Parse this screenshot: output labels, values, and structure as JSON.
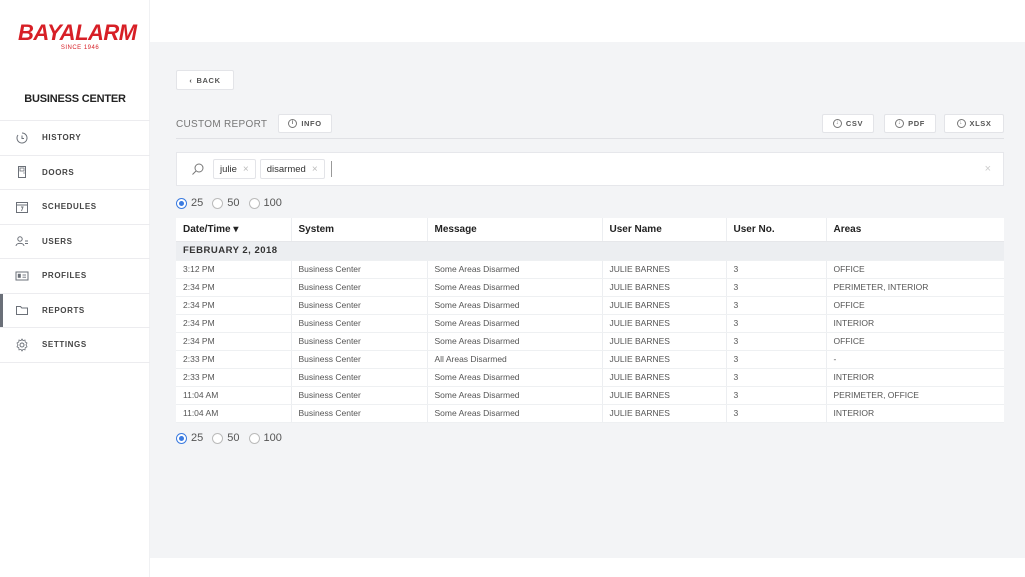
{
  "brand": {
    "name": "BAYALARM",
    "tagline": "SINCE 1946",
    "color": "#d71f26"
  },
  "account_name": "BUSINESS CENTER",
  "nav": [
    {
      "label": "HISTORY",
      "icon": "history-icon",
      "active": false
    },
    {
      "label": "DOORS",
      "icon": "door-icon",
      "active": false
    },
    {
      "label": "SCHEDULES",
      "icon": "calendar-icon",
      "active": false
    },
    {
      "label": "USERS",
      "icon": "users-icon",
      "active": false
    },
    {
      "label": "PROFILES",
      "icon": "profile-card-icon",
      "active": false
    },
    {
      "label": "REPORTS",
      "icon": "folder-icon",
      "active": true
    },
    {
      "label": "SETTINGS",
      "icon": "gear-icon",
      "active": false
    }
  ],
  "back_label": "BACK",
  "report_title": "CUSTOM REPORT",
  "info_label": "INFO",
  "exports": [
    "CSV",
    "PDF",
    "XLSX"
  ],
  "search": {
    "tags": [
      "julie",
      "disarmed"
    ],
    "tag_close": "×",
    "clear": "×"
  },
  "page_sizes": [
    "25",
    "50",
    "100"
  ],
  "selected_page_size": "25",
  "table": {
    "columns": [
      "Date/Time ▾",
      "System",
      "Message",
      "User Name",
      "User No.",
      "Areas"
    ],
    "group": "FEBRUARY 2, 2018",
    "rows": [
      [
        "3:12 PM",
        "Business Center",
        "Some Areas Disarmed",
        "JULIE BARNES",
        "3",
        "OFFICE"
      ],
      [
        "2:34 PM",
        "Business Center",
        "Some Areas Disarmed",
        "JULIE BARNES",
        "3",
        "PERIMETER, INTERIOR"
      ],
      [
        "2:34 PM",
        "Business Center",
        "Some Areas Disarmed",
        "JULIE BARNES",
        "3",
        "OFFICE"
      ],
      [
        "2:34 PM",
        "Business Center",
        "Some Areas Disarmed",
        "JULIE BARNES",
        "3",
        "INTERIOR"
      ],
      [
        "2:34 PM",
        "Business Center",
        "Some Areas Disarmed",
        "JULIE BARNES",
        "3",
        "OFFICE"
      ],
      [
        "2:33 PM",
        "Business Center",
        "All Areas Disarmed",
        "JULIE BARNES",
        "3",
        "-"
      ],
      [
        "2:33 PM",
        "Business Center",
        "Some Areas Disarmed",
        "JULIE BARNES",
        "3",
        "INTERIOR"
      ],
      [
        "11:04 AM",
        "Business Center",
        "Some Areas Disarmed",
        "JULIE BARNES",
        "3",
        "PERIMETER, OFFICE"
      ],
      [
        "11:04 AM",
        "Business Center",
        "Some Areas Disarmed",
        "JULIE BARNES",
        "3",
        "INTERIOR"
      ]
    ]
  }
}
